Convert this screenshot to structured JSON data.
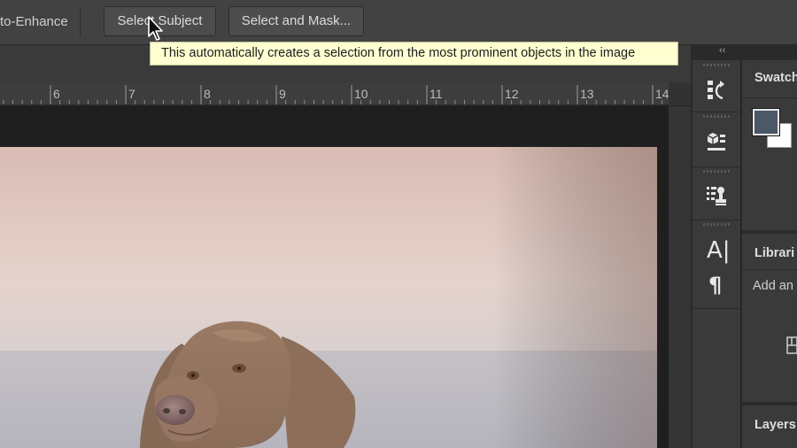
{
  "options_bar": {
    "auto_enhance_label": "to-Enhance",
    "select_subject_label": "Select Subject",
    "select_and_mask_label": "Select and Mask..."
  },
  "tooltip": {
    "text": "This automatically creates a selection from the most prominent objects in the image"
  },
  "ruler": {
    "labels": [
      "6",
      "7",
      "8",
      "9",
      "10",
      "11",
      "12",
      "13",
      "14"
    ]
  },
  "tools": {
    "collapse_glyph": "‹‹",
    "type_glyph": "A|",
    "paragraph_glyph": "¶",
    "icons": [
      "history-icon",
      "3d-icon",
      "clone-source-icon",
      "character-icon",
      "paragraph-icon"
    ]
  },
  "panels": {
    "swatches_title": "Swatch",
    "libraries_title": "Librari",
    "libraries_add_text": "Add an",
    "layers_title": "Layers"
  },
  "colors": {
    "foreground": "#4a5868",
    "background": "#ffffff",
    "tooltip_bg": "#ffffd2"
  }
}
